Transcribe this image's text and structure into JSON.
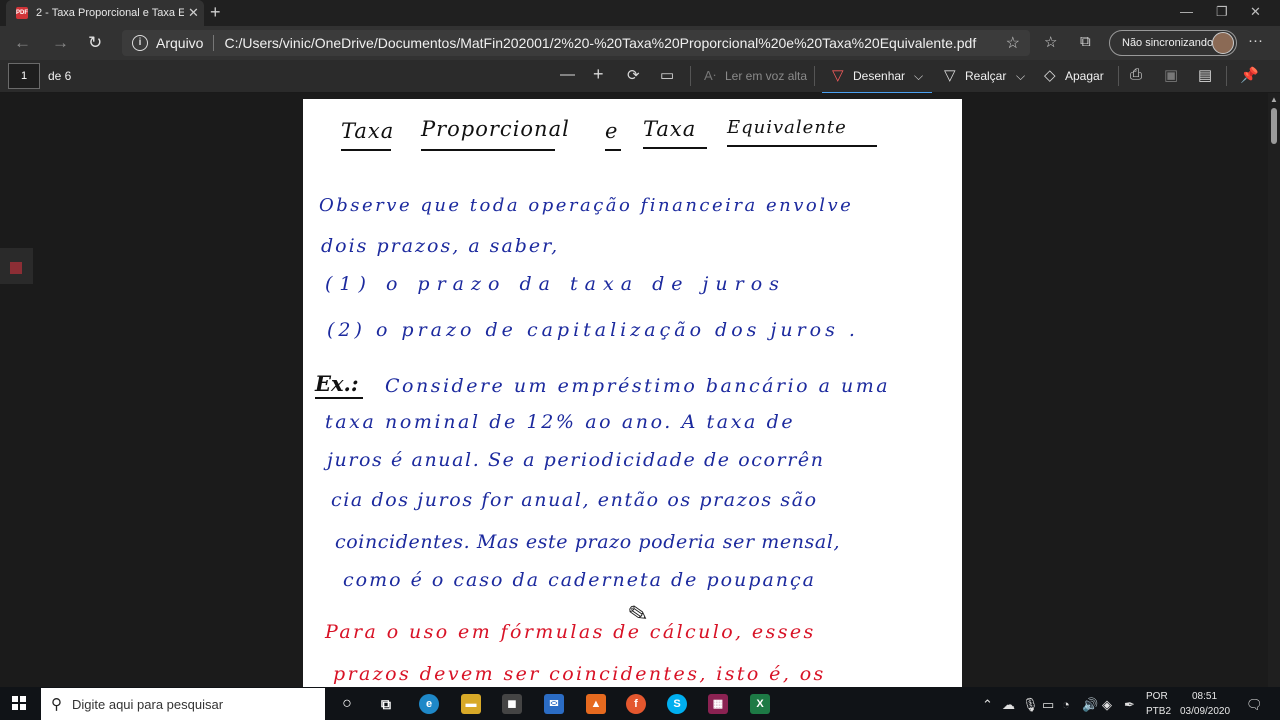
{
  "browser": {
    "tab_title": "2 - Taxa Proporcional e Taxa Equi",
    "tab_icon_text": "PDF",
    "address_scheme": "Arquivo",
    "address_url": "C:/Users/vinic/OneDrive/Documentos/MatFin202001/2%20-%20Taxa%20Proporcional%20e%20Taxa%20Equivalente.pdf",
    "sync_label": "Não sincronizando",
    "more_label": "···"
  },
  "pdf_toolbar": {
    "page_number": "1",
    "page_total": "de 6",
    "read_aloud": "Ler em voz alta",
    "draw": "Desenhar",
    "highlight": "Realçar",
    "erase": "Apagar"
  },
  "document": {
    "title_words": [
      "Taxa",
      "Proporcional",
      "e",
      "Taxa",
      "Equivalente"
    ],
    "lines_blue": [
      "Observe que toda operação financeira envolve",
      "dois prazos, a saber,",
      "(1) o prazo da taxa de juros",
      "(2) o prazo de capitalização dos juros .",
      "Considere um empréstimo bancário a uma",
      "taxa nominal de 12% ao ano. A taxa de",
      "juros é anual. Se a periodicidade de ocorrên",
      "cia dos juros for anual, então os prazos são",
      "coincidentes. Mas este prazo poderia ser mensal,",
      "como é o caso da caderneta de poupança"
    ],
    "example_label": "Ex.:",
    "lines_red": [
      "Para o uso em fórmulas de cálculo, esses",
      "prazos devem ser coincidentes, isto é, os"
    ]
  },
  "taskbar": {
    "search_placeholder": "Digite aqui para pesquisar",
    "lang_top": "POR",
    "lang_bottom": "PTB2",
    "time": "08:51",
    "date": "03/09/2020"
  }
}
